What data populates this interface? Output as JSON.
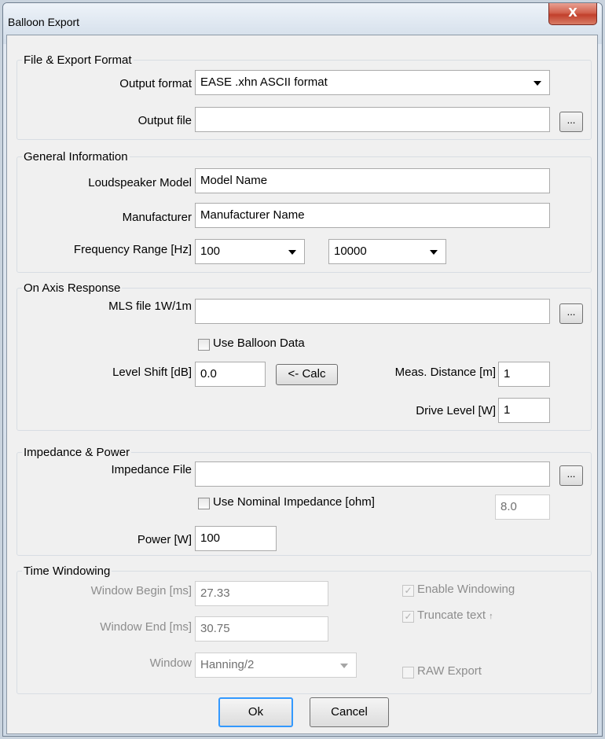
{
  "window": {
    "title": "Balloon Export",
    "close_label": "X"
  },
  "file_export": {
    "legend": "File & Export Format",
    "output_format_label": "Output format",
    "output_format_value": "EASE .xhn ASCII format",
    "output_file_label": "Output file",
    "output_file_value": "",
    "browse_label": "..."
  },
  "general": {
    "legend": "General Information",
    "model_label": "Loudspeaker Model",
    "model_value": "Model Name",
    "manufacturer_label": "Manufacturer",
    "manufacturer_value": "Manufacturer Name",
    "freq_label": "Frequency Range [Hz]",
    "freq_min": "100",
    "freq_max": "10000"
  },
  "on_axis": {
    "legend": "On Axis Response",
    "mls_label": "MLS file 1W/1m",
    "mls_value": "",
    "browse_label": "...",
    "use_balloon_label": "Use Balloon Data",
    "level_shift_label": "Level Shift [dB]",
    "level_shift_value": "0.0",
    "calc_label": "<- Calc",
    "meas_distance_label": "Meas. Distance [m]",
    "meas_distance_value": "1",
    "drive_level_label": "Drive Level [W]",
    "drive_level_value": "1"
  },
  "impedance": {
    "legend": "Impedance & Power",
    "file_label": "Impedance File",
    "file_value": "",
    "browse_label": "...",
    "use_nominal_label": "Use Nominal Impedance [ohm]",
    "nominal_value": "8.0",
    "power_label": "Power [W]",
    "power_value": "100"
  },
  "windowing": {
    "legend": "Time Windowing",
    "begin_label": "Window Begin [ms]",
    "begin_value": "27.33",
    "end_label": "Window End [ms]",
    "end_value": "30.75",
    "window_label": "Window",
    "window_value": "Hanning/2",
    "enable_label": "Enable Windowing",
    "truncate_label": "Truncate text",
    "truncate_mark": "↑",
    "raw_label": "RAW Export"
  },
  "footer": {
    "ok_label": "Ok",
    "cancel_label": "Cancel"
  }
}
